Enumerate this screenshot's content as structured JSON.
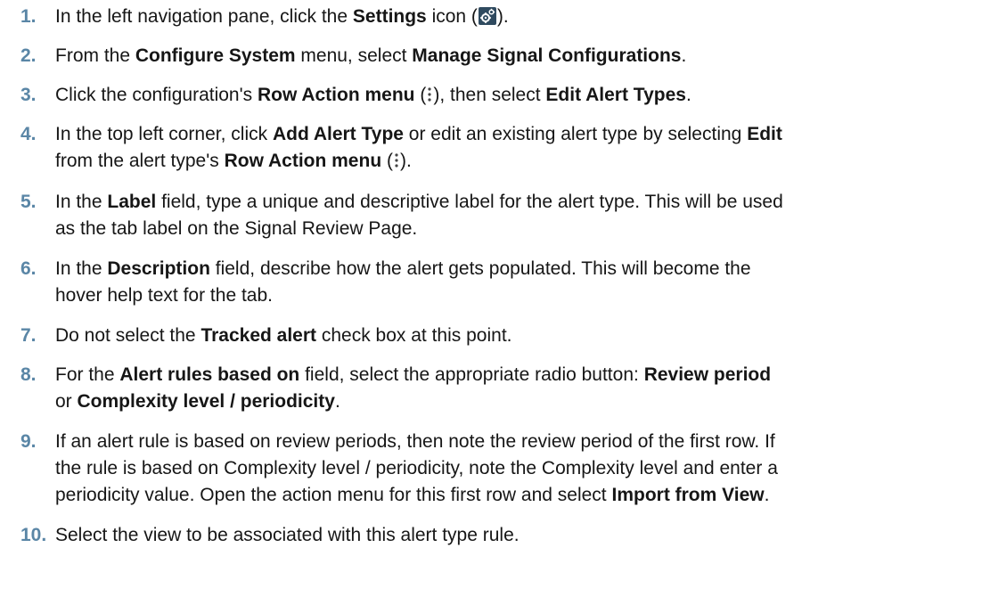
{
  "steps": [
    {
      "number": "1.",
      "parts": {
        "t1": "In the left navigation pane, click the ",
        "b1": "Settings",
        "t2": " icon (",
        "t3": ")."
      },
      "icon": "settings-gear-icon"
    },
    {
      "number": "2.",
      "parts": {
        "t1": "From the ",
        "b1": "Configure System",
        "t2": " menu, select ",
        "b2": "Manage Signal Configurations",
        "t3": "."
      }
    },
    {
      "number": "3.",
      "parts": {
        "t1": "Click the configuration's ",
        "b1": "Row Action menu",
        "t2": " (",
        "t3": "), then select ",
        "b2": "Edit Alert Types",
        "t4": "."
      },
      "icon": "row-action-kebab-icon"
    },
    {
      "number": "4.",
      "parts": {
        "t1": "In the top left corner, click ",
        "b1": "Add Alert Type",
        "t2": " or edit an existing alert type by selecting ",
        "b2": "Edit",
        "t3": "from the alert type's ",
        "b3": "Row Action menu",
        "t4": " (",
        "t5": ")."
      },
      "icon": "row-action-kebab-icon"
    },
    {
      "number": "5.",
      "parts": {
        "t1": "In the ",
        "b1": "Label",
        "t2": " field, type a unique and descriptive label for the alert type. This will be used",
        "t3": "as the tab label on the Signal Review Page."
      }
    },
    {
      "number": "6.",
      "parts": {
        "t1": "In the ",
        "b1": "Description",
        "t2": " field, describe how the alert gets populated. This will become the",
        "t3": "hover help text for the tab."
      }
    },
    {
      "number": "7.",
      "parts": {
        "t1": "Do not select the ",
        "b1": "Tracked alert",
        "t2": " check box at this point."
      }
    },
    {
      "number": "8.",
      "parts": {
        "t1": "For the ",
        "b1": "Alert rules based on",
        "t2": " field, select the appropriate radio button: ",
        "b2": "Review period",
        "t3": "or ",
        "b3": "Complexity level / periodicity",
        "t4": "."
      }
    },
    {
      "number": "9.",
      "parts": {
        "t1": "If an alert rule is based on review periods, then note the review period of the first row. If",
        "t2": "the rule is based on Complexity level / periodicity, note the Complexity level and enter a",
        "t3": "periodicity value. Open the action menu for this first row and select ",
        "b1": "Import from View",
        "t4": "."
      }
    },
    {
      "number": "10.",
      "parts": {
        "t1": "Select the view to be associated with this alert type rule."
      }
    }
  ],
  "colors": {
    "step_number": "#5a86a6",
    "body_text": "#161616",
    "gear_background": "#2f4a5f",
    "gear_foreground": "#ffffff",
    "kebab": "#444444"
  }
}
